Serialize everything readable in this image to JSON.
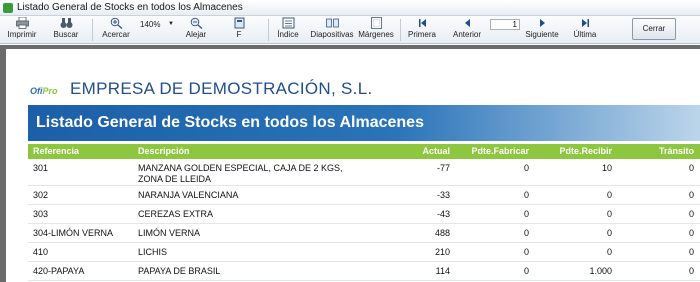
{
  "window": {
    "title": "Listado General de Stocks en todos los Almacenes"
  },
  "toolbar": {
    "print": "Imprimir",
    "search": "Buscar",
    "zoom_in": "Acercar",
    "zoom_value": "140%",
    "zoom_out": "Alejar",
    "fit": "F",
    "index": "Índice",
    "slides": "Diapositivas",
    "margins": "Márgenes",
    "first": "Primera",
    "previous": "Anterior",
    "page": "1",
    "next": "Siguiente",
    "last": "Última",
    "close": "Cerrar"
  },
  "report": {
    "logo_part1": "Ofi",
    "logo_part2": "Pro",
    "company": "EMPRESA DE DEMOSTRACIÓN, S.L.",
    "title": "Listado General de Stocks en todos los Almacenes",
    "columns": {
      "ref": "Referencia",
      "desc": "Descripción",
      "actual": "Actual",
      "fabricar": "Pdte.Fabricar",
      "recibir": "Pdte.Recibir",
      "transito": "Tránsito"
    },
    "rows": [
      {
        "ref": "301",
        "desc": "MANZANA GOLDEN ESPECIAL, CAJA DE 2 KGS,  ZONA DE LLEIDA",
        "actual": "-77",
        "fabricar": "0",
        "recibir": "10",
        "transito": "0"
      },
      {
        "ref": "302",
        "desc": "NARANJA VALENCIANA",
        "actual": "-33",
        "fabricar": "0",
        "recibir": "0",
        "transito": "0"
      },
      {
        "ref": "303",
        "desc": "CEREZAS EXTRA",
        "actual": "-43",
        "fabricar": "0",
        "recibir": "0",
        "transito": "0"
      },
      {
        "ref": "304-LIMÓN VERNA",
        "desc": "LIMÓN VERNA",
        "actual": "488",
        "fabricar": "0",
        "recibir": "0",
        "transito": "0"
      },
      {
        "ref": "410",
        "desc": "LICHIS",
        "actual": "210",
        "fabricar": "0",
        "recibir": "0",
        "transito": "0"
      },
      {
        "ref": "420-PAPAYA",
        "desc": "PAPAYA DE BRASIL",
        "actual": "114",
        "fabricar": "0",
        "recibir": "1.000",
        "transito": "0"
      }
    ]
  }
}
